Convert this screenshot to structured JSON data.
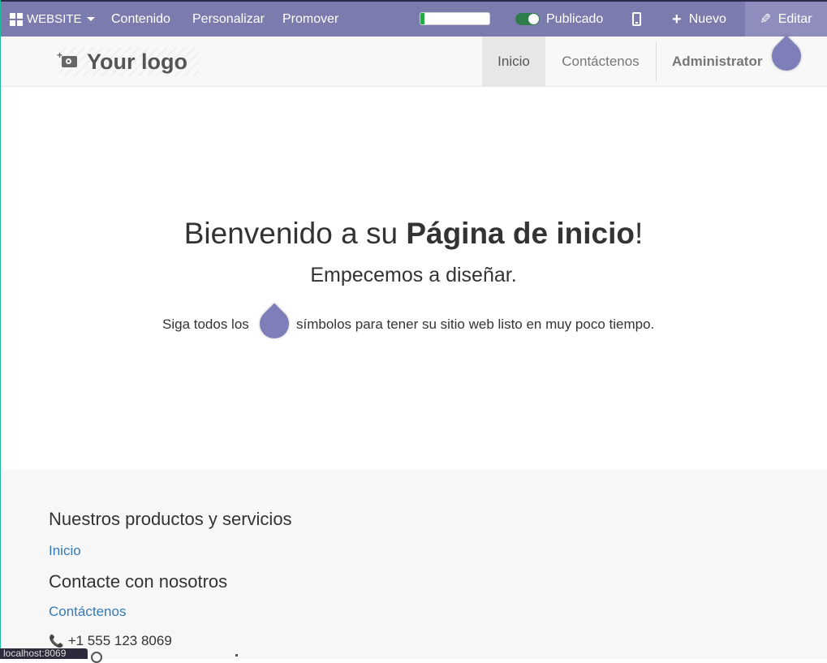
{
  "topbar": {
    "website_label": "WEBSITE",
    "contenido": "Contenido",
    "personalizar": "Personalizar",
    "promover": "Promover",
    "progress_percent": 6,
    "published_label": "Publicado",
    "nuevo_label": "Nuevo",
    "editar_label": "Editar"
  },
  "header": {
    "logo_text": "Your logo",
    "nav": [
      "Inicio",
      "Contáctenos"
    ],
    "active_nav": "Inicio",
    "user": "Administrator"
  },
  "hero": {
    "title_prefix": "Bienvenido a su ",
    "title_bold": "Página de inicio",
    "title_suffix": "!",
    "subtitle": "Empecemos a diseñar.",
    "hint_before": "Siga todos los",
    "hint_after": "símbolos para tener su sitio web listo en muy poco tiempo."
  },
  "footer": {
    "heading_products": "Nuestros productos y servicios",
    "link_inicio": "Inicio",
    "heading_contact": "Contacte con nosotros",
    "link_contact": "Contáctenos",
    "phone": "+1 555 123 8069"
  },
  "statusbar": {
    "text": "localhost:8069"
  },
  "colors": {
    "topbar_bg": "#7c7bad",
    "accent_drop": "#7e7fb9",
    "link": "#337ab7",
    "published_toggle": "#2e7d4a"
  }
}
